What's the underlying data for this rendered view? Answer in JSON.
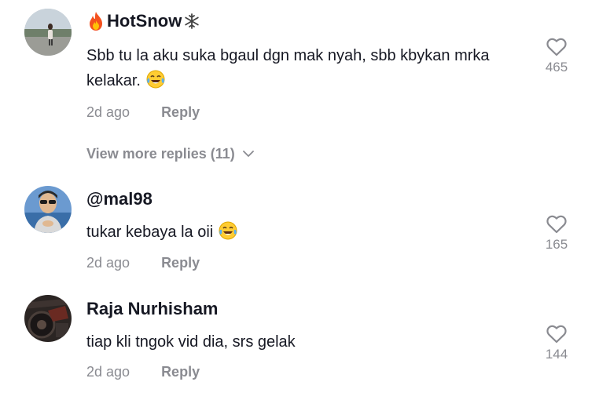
{
  "comments": [
    {
      "username": "HotSnow",
      "username_prefix_icon": "fire-emoji",
      "username_suffix_icon": "snowflake-emoji",
      "text": "Sbb tu la aku suka bgaul dgn mak nyah, sbb kbykan mrka kelakar.",
      "text_suffix_icon": "tears-of-joy-emoji",
      "time": "2d ago",
      "reply_label": "Reply",
      "likes": "465"
    },
    {
      "username": "@mal98",
      "text": "tukar kebaya la oii",
      "text_suffix_icon": "tears-of-joy-emoji",
      "time": "2d ago",
      "reply_label": "Reply",
      "likes": "165"
    },
    {
      "username": "Raja Nurhisham",
      "text": "tiap kli tngok vid dia, srs gelak",
      "time": "2d ago",
      "reply_label": "Reply",
      "likes": "144"
    }
  ],
  "view_more": {
    "label": "View more replies (11)",
    "icon": "chevron-down-icon"
  },
  "colors": {
    "primary_text": "#161823",
    "secondary_text": "#8a8b91",
    "background": "#ffffff"
  }
}
